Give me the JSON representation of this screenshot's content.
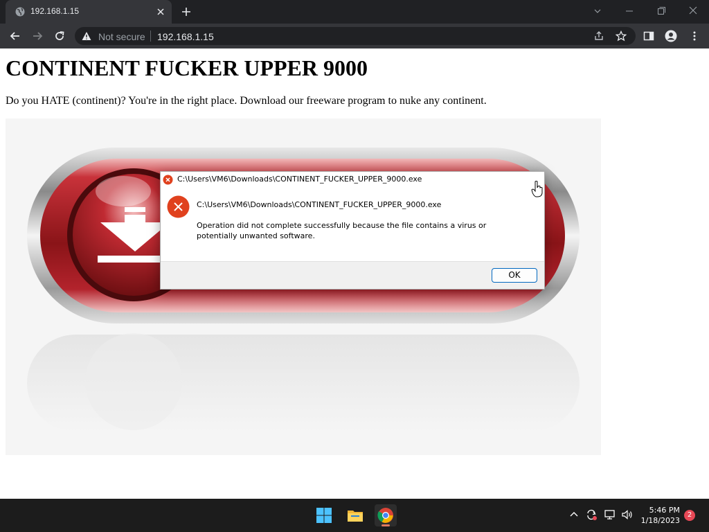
{
  "browser": {
    "tab_title": "192.168.1.15",
    "security_label": "Not secure",
    "url": "192.168.1.15"
  },
  "page": {
    "heading": "CONTINENT FUCKER UPPER 9000",
    "intro": "Do you HATE (continent)? You're in the right place. Download our freeware program to nuke any continent."
  },
  "dialog": {
    "title": "C:\\Users\\VM6\\Downloads\\CONTINENT_FUCKER_UPPER_9000.exe",
    "path": "C:\\Users\\VM6\\Downloads\\CONTINENT_FUCKER_UPPER_9000.exe",
    "message": "Operation did not complete successfully because the file contains a virus or potentially unwanted software.",
    "ok_label": "OK"
  },
  "taskbar": {
    "time": "5:46 PM",
    "date": "1/18/2023",
    "notification_count": "2"
  },
  "colors": {
    "chrome_dark": "#202124",
    "chrome_toolbar": "#35363a",
    "error_red": "#e0411e",
    "banner_red": "#b3232c",
    "taskbar": "#1c1c1c",
    "badge_red": "#e74856"
  },
  "icons": {
    "favicon": "globe-icon",
    "tab_close": "close-icon",
    "new_tab": "plus-icon",
    "security": "warning-triangle-icon",
    "dialog_error": "error-x-icon",
    "start": "windows-start-icon",
    "explorer": "folder-icon",
    "browser": "chrome-icon",
    "volume": "speaker-icon",
    "network": "network-icon"
  }
}
